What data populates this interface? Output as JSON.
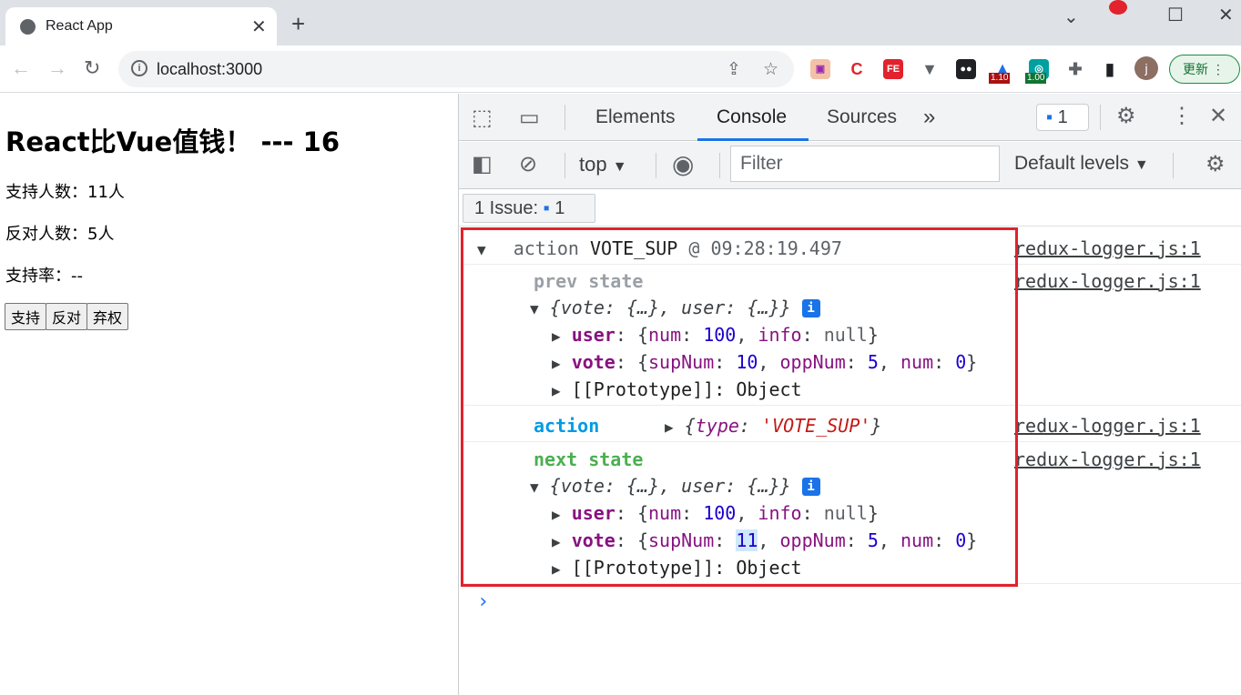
{
  "browser": {
    "tab_title": "React App",
    "url": "localhost:3000",
    "update_label": "更新",
    "avatar_letter": "j",
    "ext_badges": [
      "1.10",
      "1.00"
    ]
  },
  "page": {
    "heading": "React比Vue值钱！ --- 16",
    "support_text": "支持人数：11人",
    "oppose_text": "反对人数：5人",
    "rate_text": "支持率：--",
    "buttons": [
      "支持",
      "反对",
      "弃权"
    ]
  },
  "devtools": {
    "tabs": [
      "Elements",
      "Console",
      "Sources"
    ],
    "issues_count": "1",
    "context": "top",
    "filter_placeholder": "Filter",
    "levels": "Default levels",
    "issue_bar_label": "1 Issue:",
    "issue_bar_count": "1",
    "log": {
      "action_word": "action",
      "action_type": "VOTE_SUP",
      "at": "@ 09:28:19.497",
      "source": "redux-logger.js:1",
      "prev_label": "prev state",
      "next_label": "next state",
      "action_label": "action",
      "state_summary": "{vote: {…}, user: {…}}",
      "action_obj_key": "type",
      "action_obj_val": "'VOTE_SUP'",
      "user_label": "user",
      "vote_label": "vote",
      "proto_label": "[[Prototype]]",
      "proto_val": "Object",
      "user_num": "100",
      "user_info": "null",
      "prev_supNum": "10",
      "next_supNum": "11",
      "oppNum": "5",
      "num": "0"
    }
  }
}
